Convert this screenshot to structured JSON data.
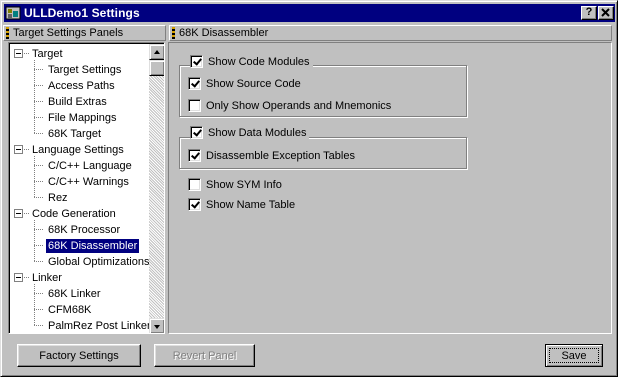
{
  "window": {
    "title": "ULLDemo1 Settings",
    "help_glyph": "?",
    "close_glyph": "✕"
  },
  "left_panel": {
    "header": "Target Settings Panels",
    "tree": [
      {
        "label": "Target",
        "level": 0,
        "expander": "minus"
      },
      {
        "label": "Target Settings",
        "level": 1
      },
      {
        "label": "Access Paths",
        "level": 1
      },
      {
        "label": "Build Extras",
        "level": 1
      },
      {
        "label": "File Mappings",
        "level": 1
      },
      {
        "label": "68K Target",
        "level": 1
      },
      {
        "label": "Language Settings",
        "level": 0,
        "expander": "minus"
      },
      {
        "label": "C/C++ Language",
        "level": 1
      },
      {
        "label": "C/C++ Warnings",
        "level": 1
      },
      {
        "label": "Rez",
        "level": 1
      },
      {
        "label": "Code Generation",
        "level": 0,
        "expander": "minus"
      },
      {
        "label": "68K Processor",
        "level": 1
      },
      {
        "label": "68K Disassembler",
        "level": 1,
        "selected": true
      },
      {
        "label": "Global Optimizations",
        "level": 1
      },
      {
        "label": "Linker",
        "level": 0,
        "expander": "minus"
      },
      {
        "label": "68K Linker",
        "level": 1
      },
      {
        "label": "CFM68K",
        "level": 1
      },
      {
        "label": "PalmRez Post Linker",
        "level": 1
      }
    ]
  },
  "right_panel": {
    "header": "68K Disassembler",
    "options": {
      "show_code_modules": {
        "label": "Show Code Modules",
        "checked": true
      },
      "show_source_code": {
        "label": "Show Source Code",
        "checked": true
      },
      "only_operands": {
        "label": "Only Show Operands and Mnemonics",
        "checked": false
      },
      "show_data_modules": {
        "label": "Show Data Modules",
        "checked": true
      },
      "disassemble_exceptions": {
        "label": "Disassemble Exception Tables",
        "checked": true
      },
      "show_sym_info": {
        "label": "Show SYM Info",
        "checked": false
      },
      "show_name_table": {
        "label": "Show Name Table",
        "checked": true
      }
    }
  },
  "buttons": {
    "factory_settings": "Factory Settings",
    "revert_panel": "Revert Panel",
    "save": "Save"
  },
  "colors": {
    "titlebar": "#000080",
    "face": "#c0c0c0",
    "selection": "#000080"
  }
}
